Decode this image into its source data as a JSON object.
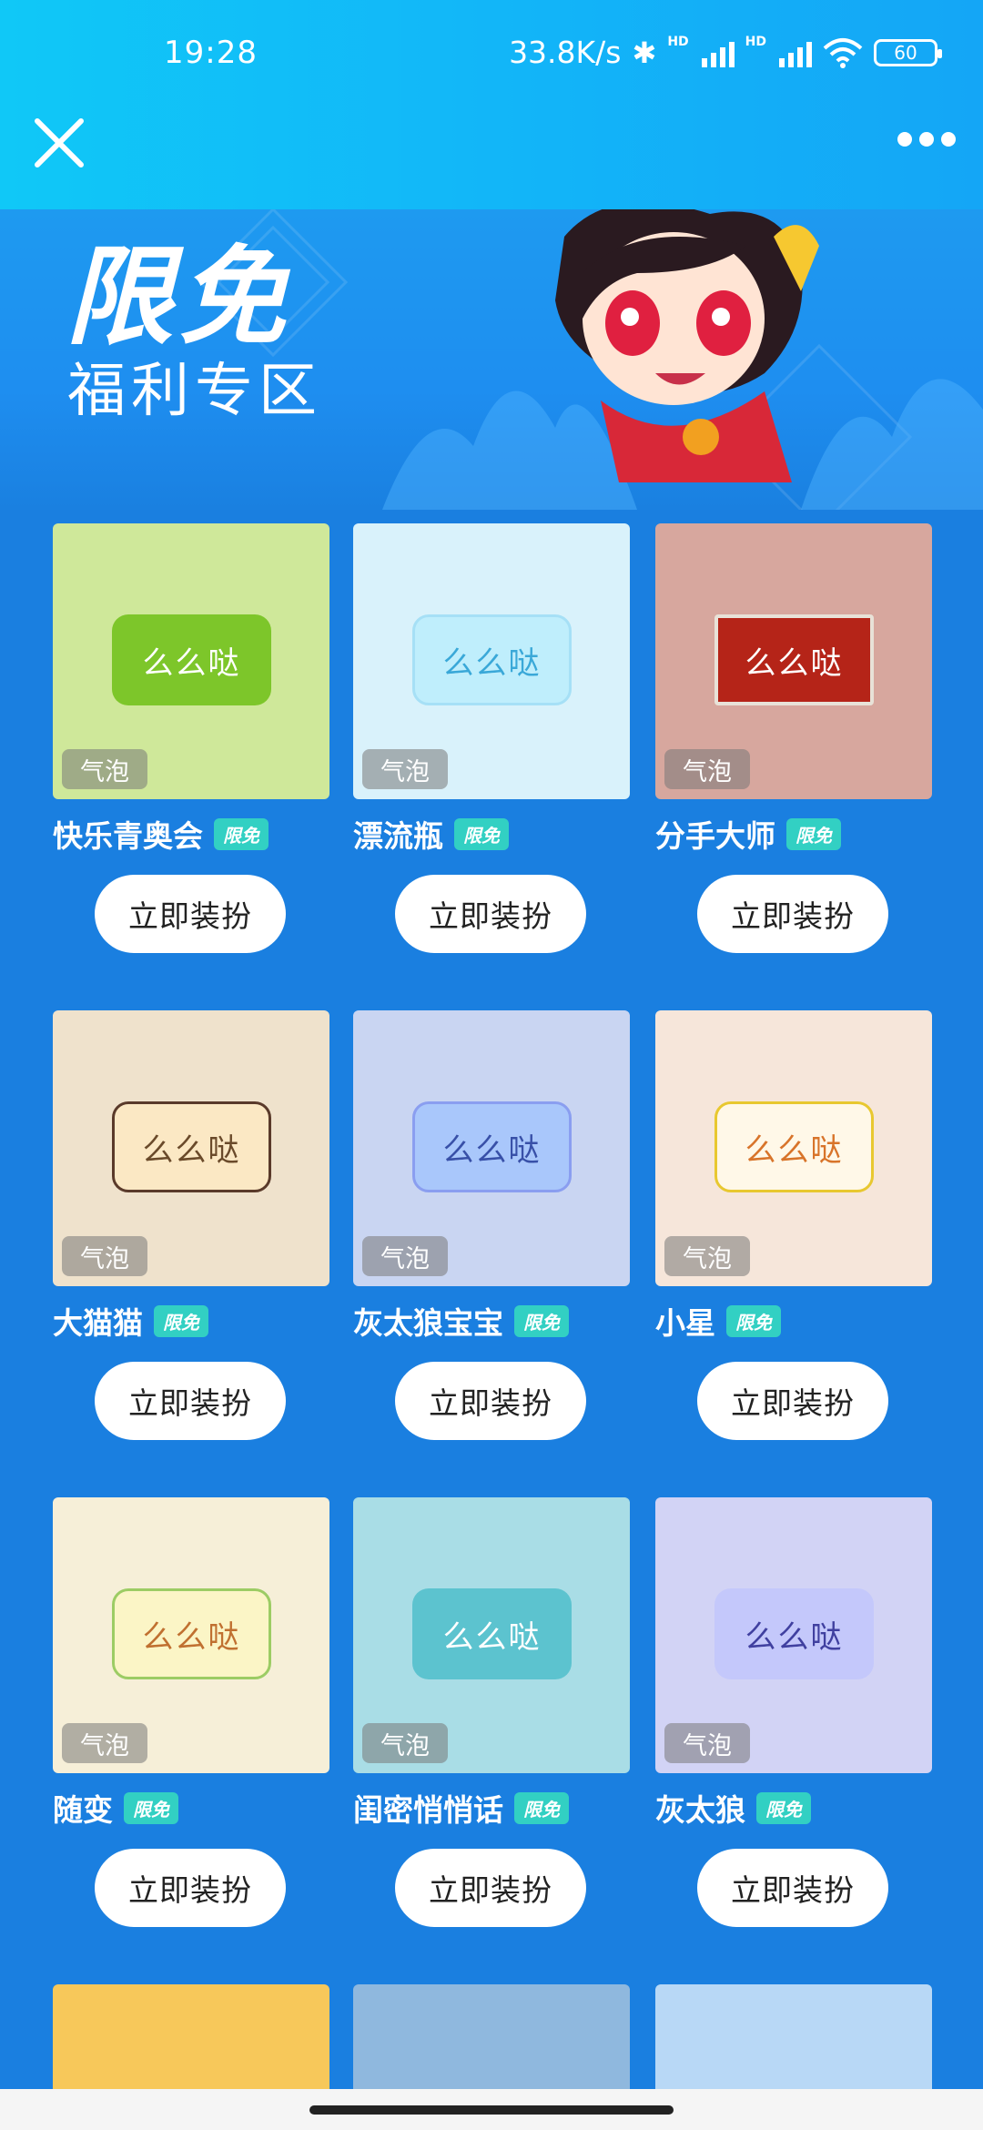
{
  "status_bar": {
    "time": "19:28",
    "net_speed": "33.8K/s",
    "hd_label": "HD",
    "battery": "60"
  },
  "header": {
    "close_icon": "close-icon",
    "more_icon": "more-icon"
  },
  "banner": {
    "title": "限免",
    "subtitle": "福利专区"
  },
  "items": [
    {
      "name": "快乐青奥会",
      "badge": "限免",
      "tag": "气泡",
      "preview": "么么哒",
      "button": "立即装扮",
      "bg": "#cfe89a",
      "bubble_bg": "#7dc62a",
      "bubble_fg": "#ffffff"
    },
    {
      "name": "漂流瓶",
      "badge": "限免",
      "tag": "气泡",
      "preview": "么么哒",
      "button": "立即装扮",
      "bg": "#d9f2fb",
      "bubble_bg": "#bfeefc",
      "bubble_fg": "#3aa8d8"
    },
    {
      "name": "分手大师",
      "badge": "限免",
      "tag": "气泡",
      "preview": "么么哒",
      "button": "立即装扮",
      "bg": "#d7a79e",
      "bubble_bg": "#b52418",
      "bubble_fg": "#ffffff"
    },
    {
      "name": "大猫猫",
      "badge": "限免",
      "tag": "气泡",
      "preview": "么么哒",
      "button": "立即装扮",
      "bg": "#efe2cc",
      "bubble_bg": "#fbe8c4",
      "bubble_fg": "#6a4a2a"
    },
    {
      "name": "灰太狼宝宝",
      "badge": "限免",
      "tag": "气泡",
      "preview": "么么哒",
      "button": "立即装扮",
      "bg": "#c9d5f2",
      "bubble_bg": "#a9c7fb",
      "bubble_fg": "#3850a8"
    },
    {
      "name": "小星",
      "badge": "限免",
      "tag": "气泡",
      "preview": "么么哒",
      "button": "立即装扮",
      "bg": "#f6e6da",
      "bubble_bg": "#fff8e8",
      "bubble_fg": "#d8742a"
    },
    {
      "name": "随变",
      "badge": "限免",
      "tag": "气泡",
      "preview": "么么哒",
      "button": "立即装扮",
      "bg": "#f6efd8",
      "bubble_bg": "#fbf5c6",
      "bubble_fg": "#c07030"
    },
    {
      "name": "闺密悄悄话",
      "badge": "限免",
      "tag": "气泡",
      "preview": "么么哒",
      "button": "立即装扮",
      "bg": "#a9dde6",
      "bubble_bg": "#5cc3cf",
      "bubble_fg": "#ffffff"
    },
    {
      "name": "灰太狼",
      "badge": "限免",
      "tag": "气泡",
      "preview": "么么哒",
      "button": "立即装扮",
      "bg": "#d2d3f5",
      "bubble_bg": "#c4c8fb",
      "bubble_fg": "#4040a0"
    }
  ],
  "peek_colors": [
    "#f7c85a",
    "#8fb8de",
    "#b8d8f6"
  ]
}
